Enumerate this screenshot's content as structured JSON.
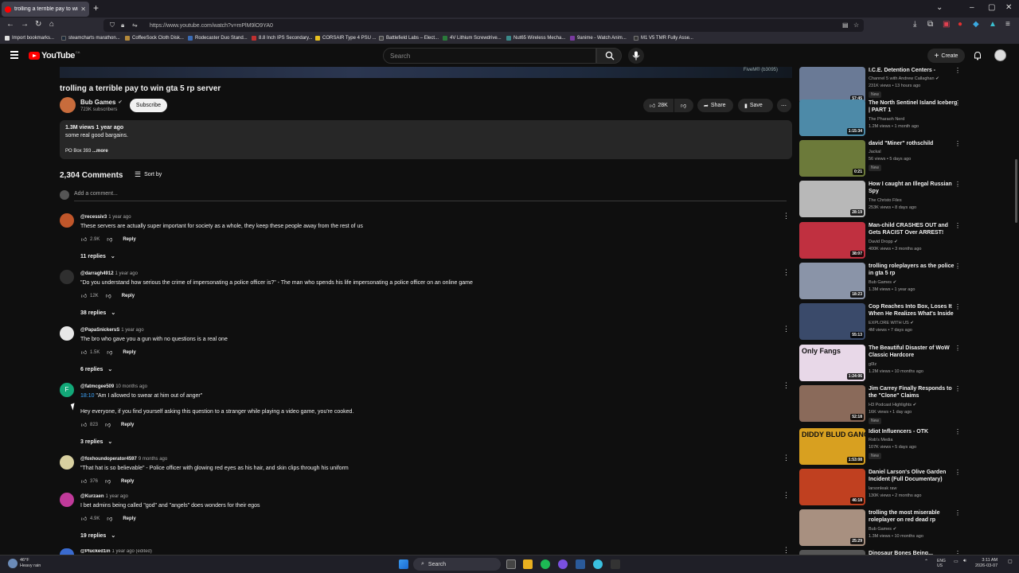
{
  "browser": {
    "tab_title": "trolling a terrible pay to win gta 5 rp server",
    "url": "https://www.youtube.com/watch?v=mPlM9lO9YA0",
    "bookmarks": [
      {
        "label": "Import bookmarks...",
        "color": "#e0e0e0"
      },
      {
        "label": "steamcharts marathon...",
        "color": "#1b2838"
      },
      {
        "label": "CoffeeSock Cloth Disk...",
        "color": "#b58a3a"
      },
      {
        "label": "Rodecaster Duo Stand...",
        "color": "#3a6bb5"
      },
      {
        "label": "8.8 Inch IPS Secondary...",
        "color": "#c03030"
      },
      {
        "label": "CORSAIR Type 4 PSU ...",
        "color": "#e8c020"
      },
      {
        "label": "Battlefield Labs – Elect...",
        "color": "#444444"
      },
      {
        "label": "4V Lithium Screwdrive...",
        "color": "#2a7a3a"
      },
      {
        "label": "Nut65 Wireless Mecha...",
        "color": "#3a8a8a"
      },
      {
        "label": "9anime - Watch Anim...",
        "color": "#7a3aa0"
      },
      {
        "label": "M1 V5 TMR Fully Asse...",
        "color": "#333333"
      }
    ]
  },
  "header": {
    "logo_text": "YouTube",
    "region": "CA",
    "search_placeholder": "Search",
    "create_label": "Create"
  },
  "video": {
    "watermark": "FiveM® (b3095)",
    "title": "trolling a terrible pay to win gta 5 rp server",
    "channel": "Bub Games",
    "subscribers": "723K subscribers",
    "subscribe_label": "Subscribe",
    "likes": "28K",
    "share_label": "Share",
    "save_label": "Save",
    "views_date": "1.3M views  1 year ago",
    "description": "some real good bargains.",
    "po_box": "PO Box 393",
    "more_label": "...more"
  },
  "comments": {
    "count_label": "2,304 Comments",
    "sort_label": "Sort by",
    "add_placeholder": "Add a comment...",
    "items": [
      {
        "user": "@recessiv3",
        "time": "1 year ago",
        "timestamp": "",
        "text": "These servers are actually super important for society as a whole, they keep these people away from the rest of us",
        "text2": "",
        "likes": "2.9K",
        "replies": "11 replies",
        "avatar_color": "#c0562a"
      },
      {
        "user": "@darragh4912",
        "time": "1 year ago",
        "timestamp": "",
        "text": "\"Do you understand how serious the crime of impersonating a police officer is?\" - The man who spends his life impersonating a police officer on an online game",
        "text2": "",
        "likes": "12K",
        "replies": "38 replies",
        "avatar_color": "#3a3a3a"
      },
      {
        "user": "@PapaSnickersS",
        "time": "1 year ago",
        "timestamp": "",
        "text": "The bro who gave you a gun with no questions is a real one",
        "text2": "",
        "likes": "1.5K",
        "replies": "6 replies",
        "avatar_color": "#e8e8e8"
      },
      {
        "user": "@fatmcgee509",
        "time": "10 months ago",
        "timestamp": "18:10",
        "text": " \"Am I allowed to swear at him out of anger\"",
        "text2": "Hey everyone, if you find yourself asking this question to a stranger while playing a video game, you're cooked.",
        "likes": "823",
        "replies": "3 replies",
        "avatar_color": "#12a878",
        "avatar_letter": "F"
      },
      {
        "user": "@foxhoundoperator4597",
        "time": "9 months ago",
        "timestamp": "",
        "text": "\"That hat is so believable\" - Police officer with glowing red eyes as his hair, and skin clips through his uniform",
        "text2": "",
        "likes": "376",
        "replies": "",
        "avatar_color": "#d8d0a0"
      },
      {
        "user": "@Kurzaen",
        "time": "1 year ago",
        "timestamp": "",
        "text": "I bet admins being called \"god\" and \"angels\" does wonders for their egos",
        "text2": "",
        "likes": "4.9K",
        "replies": "19 replies",
        "avatar_color": "#c03a9a"
      },
      {
        "user": "@Plucked1in",
        "time": "1 year ago (edited)",
        "timestamp": "",
        "text": "",
        "text2": "",
        "likes": "",
        "replies": "",
        "avatar_color": "#3a6bd0"
      }
    ]
  },
  "recommendations": [
    {
      "title": "I.C.E. Detention Centers -",
      "channel": "Channel 5 with Andrew Callaghan",
      "meta": "231K views • 13 hours ago",
      "badge": "New",
      "duration": "57:45",
      "verified": true,
      "thumb": "#6a7a96"
    },
    {
      "title": "The North Sentinel Island Iceberg | PART 1",
      "channel": "The Pharaoh Nerd",
      "meta": "1.2M views • 1 month ago",
      "badge": "",
      "duration": "1:15:34",
      "verified": false,
      "thumb": "#4d8aa8"
    },
    {
      "title": "david \"Miner\" rothschild",
      "channel": "Jackal",
      "meta": "56 views • 5 days ago",
      "badge": "New",
      "duration": "0:21",
      "verified": false,
      "thumb": "#6c7a3a"
    },
    {
      "title": "How I caught an Illegal Russian Spy",
      "channel": "The Christo Files",
      "meta": "253K views • 8 days ago",
      "badge": "",
      "duration": "28:19",
      "verified": false,
      "thumb": "#b8b8b8"
    },
    {
      "title": "Man-child CRASHES OUT and Gets RACIST Over ARREST!",
      "channel": "David Dropp",
      "meta": "400K views • 3 months ago",
      "badge": "",
      "duration": "38:07",
      "verified": true,
      "thumb": "#c03040"
    },
    {
      "title": "trolling roleplayers as the police in gta 5 rp",
      "channel": "Bub Games",
      "meta": "1.3M views • 1 year ago",
      "badge": "",
      "duration": "18:23",
      "verified": true,
      "thumb": "#8a94a8"
    },
    {
      "title": "Cop Reaches Into Box, Loses It When He Realizes What's Inside",
      "channel": "EXPLORE WITH US",
      "meta": "4M views • 7 days ago",
      "badge": "",
      "duration": "55:13",
      "verified": true,
      "thumb": "#3a4a6a"
    },
    {
      "title": "The Beautiful Disaster of WoW Classic Hardcore",
      "channel": "g0lz",
      "meta": "1.2M views • 10 months ago",
      "badge": "",
      "duration": "1:24:06",
      "verified": false,
      "thumb": "#e8d8e8",
      "thumb_text": "Only Fangs"
    },
    {
      "title": "Jim Carrey Finally Responds to the \"Clone\" Claims",
      "channel": "H3 Podcast Highlights",
      "meta": "16K views • 1 day ago",
      "badge": "New",
      "duration": "52:18",
      "verified": true,
      "thumb": "#8a6a5a"
    },
    {
      "title": "Idiot Influencers - OTK",
      "channel": "Rob's Media",
      "meta": "107K views • 5 days ago",
      "badge": "New",
      "duration": "1:53:08",
      "verified": false,
      "thumb": "#d8a020",
      "thumb_text": "DIDDY BLUD GANG"
    },
    {
      "title": "Daniel Larson's Olive Garden Incident (Full Documentary)",
      "channel": "larsonleak raw",
      "meta": "130K views • 2 months ago",
      "badge": "",
      "duration": "46:18",
      "verified": false,
      "thumb": "#c04020"
    },
    {
      "title": "trolling the most miserable roleplayer on red dead rp",
      "channel": "Bub Games",
      "meta": "1.3M views • 10 months ago",
      "badge": "",
      "duration": "25:29",
      "verified": true,
      "thumb": "#a89080"
    },
    {
      "title": "Dinosaur Bones Being...",
      "channel": "",
      "meta": "",
      "badge": "",
      "duration": "",
      "verified": false,
      "thumb": "#555555"
    }
  ],
  "taskbar": {
    "weather_temp": "46°F",
    "weather_desc": "Heavy rain",
    "search_label": "Search",
    "lang1": "ENG",
    "lang2": "US",
    "time": "3:11 AM",
    "date": "2026-03-07"
  }
}
